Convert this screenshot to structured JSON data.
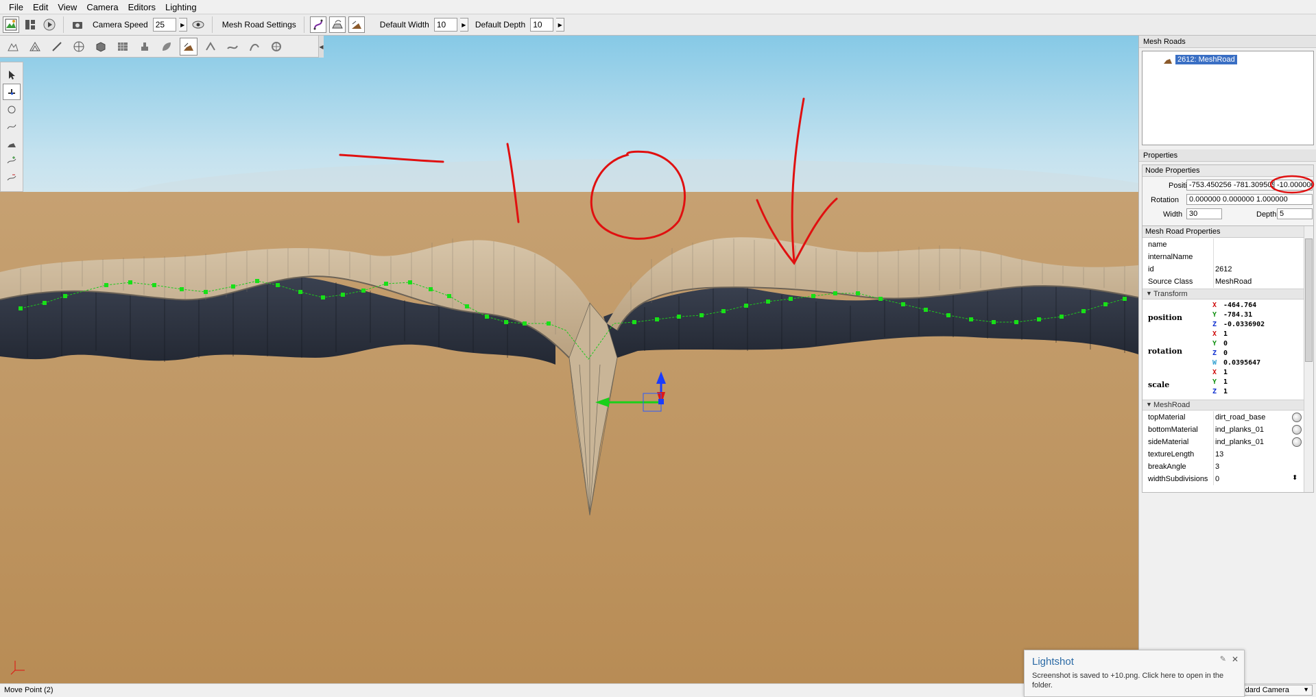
{
  "menu": [
    "File",
    "Edit",
    "View",
    "Camera",
    "Editors",
    "Lighting"
  ],
  "toolbar": {
    "camera_speed_label": "Camera Speed",
    "camera_speed_value": "25",
    "mesh_road_settings_label": "Mesh Road Settings",
    "default_width_label": "Default Width",
    "default_width_value": "10",
    "default_depth_label": "Default Depth",
    "default_depth_value": "10"
  },
  "annotation": {
    "text": "-10",
    "color": "#e01010"
  },
  "mesh_roads_panel": {
    "title": "Mesh Roads",
    "item_label": "2612: MeshRoad"
  },
  "properties": {
    "title": "Properties",
    "node": {
      "section": "Node Properties",
      "position_label": "Position",
      "position_value": "-753.450256 -781.309509",
      "position_z": "-10.000000",
      "rotation_label": "Rotation",
      "rotation_value": "0.000000 0.000000 1.000000",
      "width_label": "Width",
      "width_value": "30",
      "depth_label": "Depth",
      "depth_value": "5"
    },
    "meshroad": {
      "section": "Mesh Road Properties",
      "name_label": "name",
      "name_value": "",
      "internal_label": "internalName",
      "internal_value": "",
      "id_label": "id",
      "id_value": "2612",
      "class_label": "Source Class",
      "class_value": "MeshRoad",
      "transform_group": "Transform",
      "position_label": "position",
      "position": {
        "x": "-464.764",
        "y": "-784.31",
        "z": "-0.0336902"
      },
      "rotation_label": "rotation",
      "rotation": {
        "x": "1",
        "y": "0",
        "z": "0",
        "w": "0.0395647"
      },
      "scale_label": "scale",
      "scale": {
        "x": "1",
        "y": "1",
        "z": "1"
      },
      "meshroad_group": "MeshRoad",
      "top_label": "topMaterial",
      "top_value": "dirt_road_base",
      "bottom_label": "bottomMaterial",
      "bottom_value": "ind_planks_01",
      "side_label": "sideMaterial",
      "side_value": "ind_planks_01",
      "texlen_label": "textureLength",
      "texlen_value": "13",
      "break_label": "breakAngle",
      "break_value": "3",
      "widthsub_label": "widthSubdivisions",
      "widthsub_value": "0"
    }
  },
  "status": {
    "text": "Move Point (2)",
    "camera": "Standard Camera"
  },
  "lightshot": {
    "title": "Lightshot",
    "message": "Screenshot is saved to +10.png. Click here to open in the folder."
  }
}
